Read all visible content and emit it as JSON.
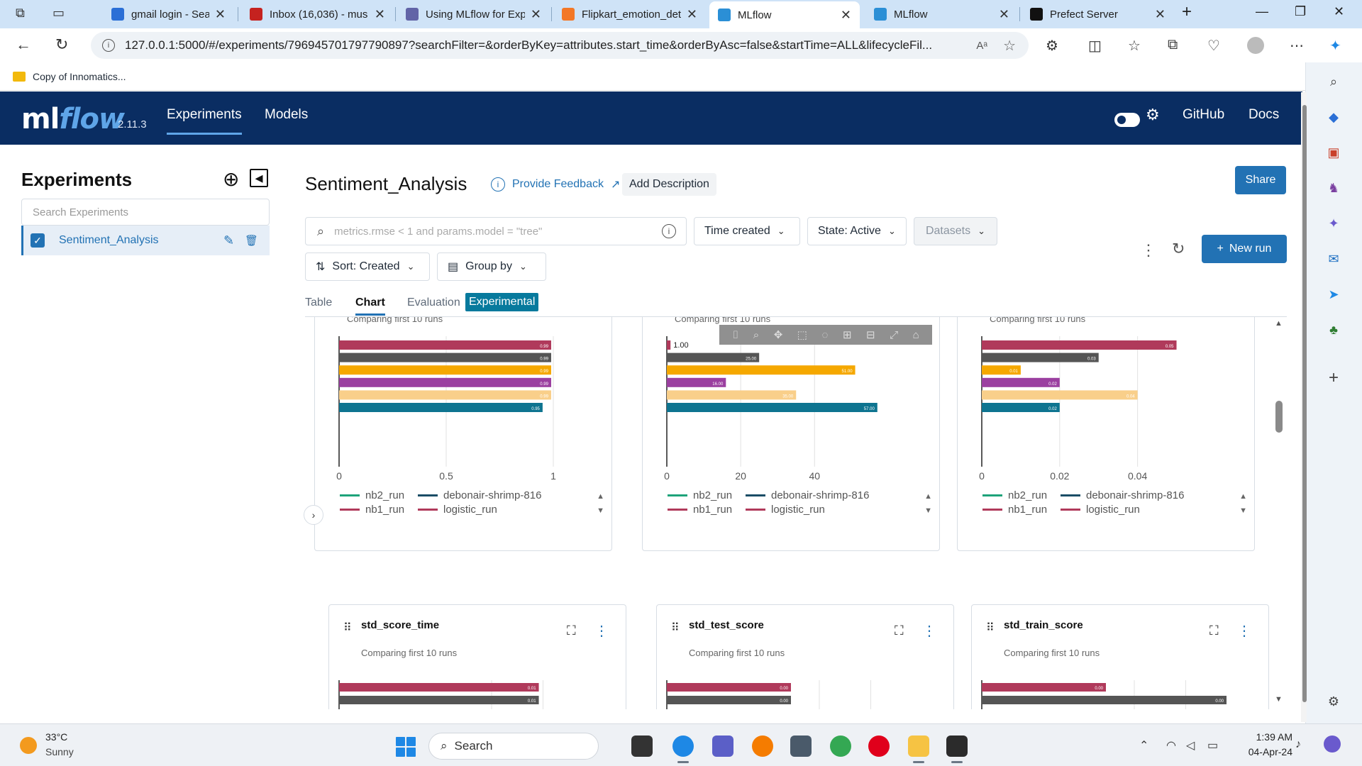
{
  "browser": {
    "tabs": [
      {
        "title": "gmail login - Search",
        "color": "#2b6fd6"
      },
      {
        "title": "Inbox (16,036) - mus",
        "color": "#c5221f"
      },
      {
        "title": "Using MLflow for Exp",
        "color": "#6264a7"
      },
      {
        "title": "Flipkart_emotion_det",
        "color": "#f37726"
      },
      {
        "title": "MLflow",
        "color": "#2b8fd6"
      },
      {
        "title": "MLflow",
        "color": "#2b8fd6"
      },
      {
        "title": "Prefect Server",
        "color": "#111111"
      }
    ],
    "url": "127.0.0.1:5000/#/experiments/796945701797790897?searchFilter=&orderByKey=attributes.start_time&orderByAsc=false&startTime=ALL&lifecycleFil...",
    "bookmark": "Copy of Innomatics..."
  },
  "header": {
    "logo_ml": "ml",
    "logo_flow": "flow",
    "version": "2.11.3",
    "nav": [
      "Experiments",
      "Models"
    ],
    "right_links": [
      "GitHub",
      "Docs"
    ]
  },
  "sidebar": {
    "title": "Experiments",
    "search_placeholder": "Search Experiments",
    "experiments": [
      {
        "name": "Sentiment_Analysis",
        "checked": true
      }
    ]
  },
  "main": {
    "title": "Sentiment_Analysis",
    "feedback": "Provide Feedback",
    "add_description": "Add Description",
    "share": "Share",
    "search_placeholder": "metrics.rmse < 1 and params.model = \"tree\"",
    "filters": {
      "time_created": "Time created",
      "state": "State: Active",
      "datasets": "Datasets",
      "sort": "Sort: Created",
      "group_by": "Group by"
    },
    "new_run": "New run",
    "view_tabs": [
      "Table",
      "Chart",
      "Evaluation"
    ],
    "experimental_badge": "Experimental"
  },
  "legend": {
    "entries": [
      {
        "name": "nb2_run",
        "color": "#1ea37a"
      },
      {
        "name": "debonair-shrimp-816",
        "color": "#1a4d66"
      },
      {
        "name": "nb1_run",
        "color": "#b03a5b"
      },
      {
        "name": "logistic_run",
        "color": "#b03a5b"
      }
    ]
  },
  "chart_data": [
    {
      "type": "bar",
      "orientation": "horizontal",
      "subtitle": "Comparing first 10 runs",
      "values": [
        0.99,
        0.99,
        0.99,
        0.99,
        0.99,
        0.95
      ],
      "labels": [
        "0.99",
        "0.99",
        "0.99",
        "0.99",
        "0.99",
        "0.95"
      ],
      "colors": [
        "#b03a5b",
        "#555555",
        "#f5a800",
        "#9b3fa0",
        "#f9cf8a",
        "#0e7490"
      ],
      "xlim": [
        0,
        1
      ],
      "xticks": [
        {
          "v": 0,
          "label": "0"
        },
        {
          "v": 0.5,
          "label": "0.5"
        },
        {
          "v": 1,
          "label": "1"
        }
      ]
    },
    {
      "type": "bar",
      "orientation": "horizontal",
      "subtitle": "Comparing first 10 runs",
      "values": [
        1,
        25,
        51,
        16,
        35,
        57
      ],
      "labels": [
        "1.00",
        "25.00",
        "51.00",
        "16.00",
        "35.00",
        "57.00"
      ],
      "colors": [
        "#b03a5b",
        "#555555",
        "#f5a800",
        "#9b3fa0",
        "#f9cf8a",
        "#0e7490"
      ],
      "xlim": [
        0,
        58
      ],
      "xticks": [
        {
          "v": 0,
          "label": "0"
        },
        {
          "v": 20,
          "label": "20"
        },
        {
          "v": 40,
          "label": "40"
        }
      ]
    },
    {
      "type": "bar",
      "orientation": "horizontal",
      "subtitle": "Comparing first 10 runs",
      "values": [
        0.05,
        0.03,
        0.01,
        0.02,
        0.04,
        0.02
      ],
      "labels": [
        "0.05",
        "0.03",
        "0.01",
        "0.02",
        "0.04",
        "0.02"
      ],
      "colors": [
        "#b03a5b",
        "#555555",
        "#f5a800",
        "#9b3fa0",
        "#f9cf8a",
        "#0e7490"
      ],
      "xlim": [
        0,
        0.055
      ],
      "xticks": [
        {
          "v": 0,
          "label": "0"
        },
        {
          "v": 0.02,
          "label": "0.02"
        },
        {
          "v": 0.04,
          "label": "0.04"
        }
      ]
    },
    {
      "type": "bar",
      "orientation": "horizontal",
      "title": "std_score_time",
      "subtitle": "Comparing first 10 runs",
      "values": [
        0.01,
        0.01
      ],
      "labels": [
        "0.01",
        "0.01"
      ],
      "colors": [
        "#b03a5b",
        "#555555"
      ],
      "xlim": [
        0,
        0.0103
      ]
    },
    {
      "type": "bar",
      "orientation": "horizontal",
      "title": "std_test_score",
      "subtitle": "Comparing first 10 runs",
      "values": [
        0.0,
        0.0
      ],
      "labels": [
        "0.00",
        "0.00"
      ],
      "colors": [
        "#b03a5b",
        "#555555"
      ],
      "xlim": [
        0,
        1
      ]
    },
    {
      "type": "bar",
      "orientation": "horizontal",
      "title": "std_train_score",
      "subtitle": "Comparing first 10 runs",
      "values": [
        0.0,
        0.0
      ],
      "labels": [
        "0.00",
        "0.00"
      ],
      "colors": [
        "#b03a5b",
        "#555555"
      ],
      "xlim": [
        0,
        1
      ]
    }
  ],
  "taskbar": {
    "temp": "33°C",
    "condition": "Sunny",
    "search": "Search",
    "time": "1:39 AM",
    "date": "04-Apr-24"
  }
}
